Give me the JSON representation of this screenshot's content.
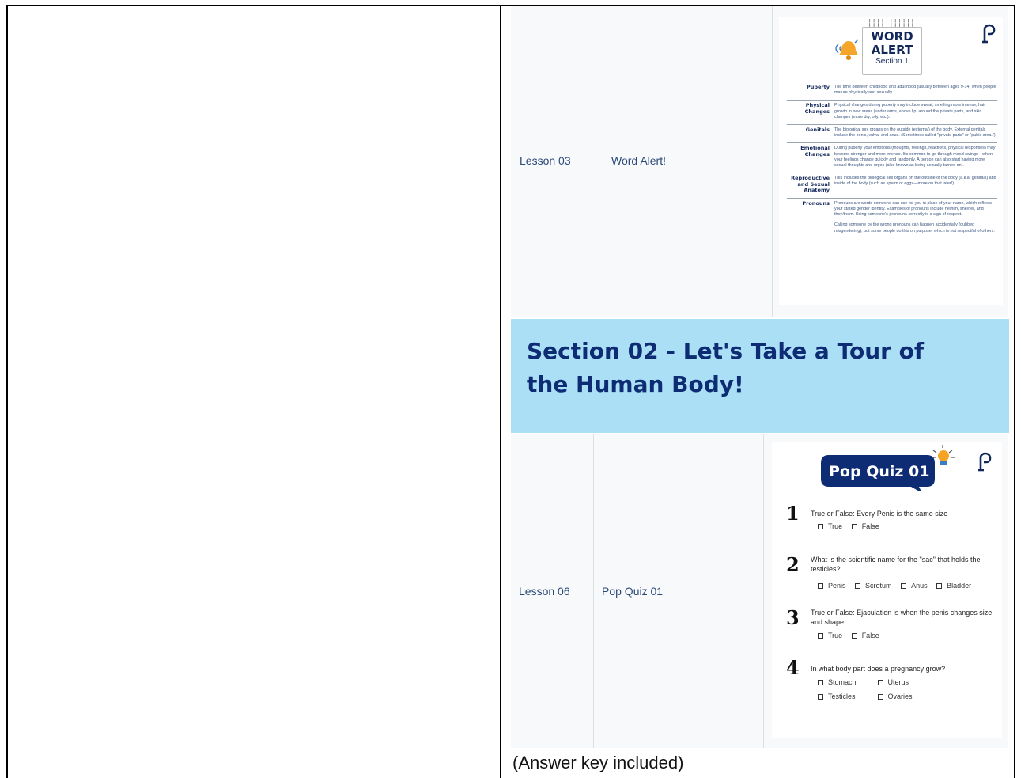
{
  "lesson03": {
    "lesson": "Lesson 03",
    "title": "Word Alert!",
    "image": {
      "heading_line1": "WORD",
      "heading_line2": "ALERT",
      "subheading": "Section 1",
      "terms": [
        {
          "term": "Puberty",
          "definition": "The time between childhood and adulthood (usually between ages 9-14) when people mature physically and sexually."
        },
        {
          "term": "Physical Changes",
          "definition": "Physical changes during puberty may include sweat, smelling more intense, hair growth in new areas (under arms, above lip, around the private parts, and skin changes (more dry, oily, etc.)."
        },
        {
          "term": "Genitals",
          "definition": "The biological sex organs on the outside (external) of the body. External genitals include the penis, vulva, and anus. (Sometimes called \"private parts\" or \"pubic area.\")"
        },
        {
          "term": "Emotional Changes",
          "definition": "During puberty your emotions (thoughts, feelings, reactions, physical responses) may become stronger and more intense. It's common to go through mood swings—when your feelings change quickly and randomly. A person can also start having more sexual thoughts and urges (also known as being sexually turned on)."
        },
        {
          "term": "Reproductive and Sexual Anatomy",
          "definition": "This includes the biological sex organs on the outside of the body (a.k.a. genitals) and inside of the body (such as sperm or eggs—more on that later!)."
        },
        {
          "term": "Pronouns",
          "definition": "Pronouns are words someone can use for you in place of your name, which reflects your stated gender identity. Examples of pronouns include he/him, she/her, and they/them. Using someone's pronouns correctly is a sign of respect."
        },
        {
          "term": "",
          "definition": "Calling someone by the wrong pronouns can happen accidentally (dubbed misgendering), but some people do this on purpose, which is not respectful of others."
        }
      ]
    }
  },
  "section02": {
    "title": "Section 02 - Let's Take a Tour of the Human Body!"
  },
  "lesson06": {
    "lesson": "Lesson 06",
    "title": "Pop Quiz 01",
    "image": {
      "heading": "Pop Quiz 01",
      "questions": [
        {
          "num": "1",
          "text": "True or False: Every Penis is the same size",
          "options": [
            "True",
            "False"
          ]
        },
        {
          "num": "2",
          "text": "What is the scientific name for the \"sac\" that holds the testicles?",
          "options": [
            "Penis",
            "Scrotum",
            "Anus",
            "Bladder"
          ]
        },
        {
          "num": "3",
          "text": "True or False: Ejaculation is when the penis changes size and shape.",
          "options": [
            "True",
            "False"
          ]
        },
        {
          "num": "4",
          "text": "In what body part does a pregnancy grow?",
          "options_row1": [
            "Stomach",
            "Uterus"
          ],
          "options_row2": [
            "Testicles",
            "Ovaries"
          ]
        }
      ]
    }
  },
  "answer_note": "(Answer key included)",
  "colors": {
    "section_band": "#abdff6",
    "section_title": "#0d2c73",
    "link_text": "#2b4a7a",
    "table_bg": "#f8f9fa"
  }
}
